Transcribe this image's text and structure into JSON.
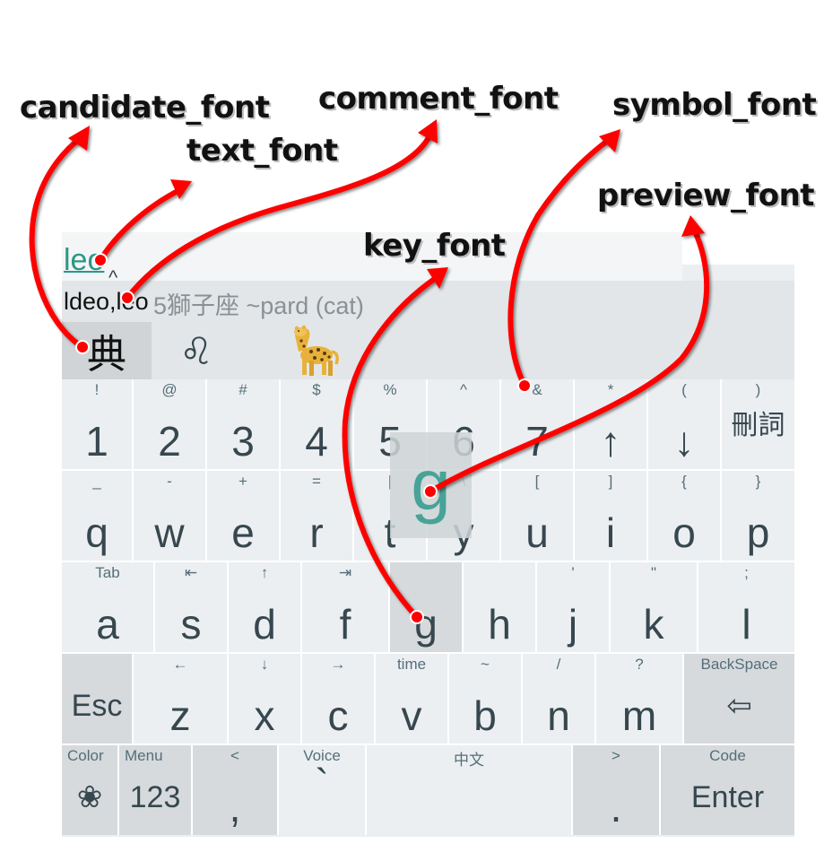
{
  "annotations": {
    "candidate_font": "candidate_font",
    "text_font": "text_font",
    "comment_font": "comment_font",
    "symbol_font": "symbol_font",
    "preview_font": "preview_font",
    "key_font": "key_font"
  },
  "composition": {
    "text": "leo",
    "caret": "^"
  },
  "comment": {
    "prefix": "ldeo,leo",
    "text": "5獅子座 ~pard (cat)"
  },
  "candidates": [
    {
      "label": "典"
    },
    {
      "label": "♌"
    },
    {
      "label": "leopard-emoji"
    }
  ],
  "rows": [
    [
      {
        "sym": "!",
        "main": "1"
      },
      {
        "sym": "@",
        "main": "2"
      },
      {
        "sym": "#",
        "main": "3"
      },
      {
        "sym": "$",
        "main": "4"
      },
      {
        "sym": "%",
        "main": "5"
      },
      {
        "sym": "^",
        "main": "6"
      },
      {
        "sym": "&",
        "main": "7"
      },
      {
        "sym": "*",
        "main": "↑"
      },
      {
        "sym": "(",
        "main": "↓"
      },
      {
        "sym": ")",
        "main": "刪詞"
      }
    ],
    [
      {
        "sym": "_",
        "main": "q"
      },
      {
        "sym": "-",
        "main": "w"
      },
      {
        "sym": "+",
        "main": "e"
      },
      {
        "sym": "=",
        "main": "r"
      },
      {
        "sym": "|",
        "main": "t"
      },
      {
        "sym": "\\",
        "main": "y"
      },
      {
        "sym": "[",
        "main": "u"
      },
      {
        "sym": "]",
        "main": "i"
      },
      {
        "sym": "{",
        "main": "o"
      },
      {
        "sym": "}",
        "main": "p"
      }
    ],
    [
      {
        "sym": "Tab",
        "main": "a"
      },
      {
        "sym": "⇤",
        "main": "s"
      },
      {
        "sym": "↑",
        "main": "d"
      },
      {
        "sym": "⇥",
        "main": "f"
      },
      {
        "sym": "",
        "main": "g"
      },
      {
        "sym": "",
        "main": "h"
      },
      {
        "sym": "'",
        "main": "j"
      },
      {
        "sym": "\"",
        "main": "k"
      },
      {
        "sym": ":",
        "main": "l"
      },
      {
        "sym": ";",
        "main": "l"
      }
    ],
    [
      {
        "sym": "",
        "main": "Esc"
      },
      {
        "sym": "←",
        "main": "z"
      },
      {
        "sym": "↓",
        "main": "x"
      },
      {
        "sym": "→",
        "main": "c"
      },
      {
        "sym": "time",
        "main": "v"
      },
      {
        "sym": "~",
        "main": "b"
      },
      {
        "sym": "/",
        "main": "n"
      },
      {
        "sym": "?",
        "main": "m"
      },
      {
        "sym": "BackSpace",
        "main": "⇦"
      }
    ],
    [
      {
        "sym": "Color",
        "main": "❀"
      },
      {
        "sym": "Menu",
        "main": "123"
      },
      {
        "sym": "<",
        "main": ","
      },
      {
        "sym": "Voice",
        "main": "`"
      },
      {
        "sym": "中文",
        "main": ""
      },
      {
        "sym": ">",
        "main": "."
      },
      {
        "sym": "Code",
        "main": "Enter"
      }
    ]
  ],
  "preview": {
    "char": "g"
  },
  "colors": {
    "accent": "#2b9688",
    "arrow": "#ff0000",
    "key_bg": "#eceff1",
    "dark_key_bg": "#d6dadc"
  }
}
